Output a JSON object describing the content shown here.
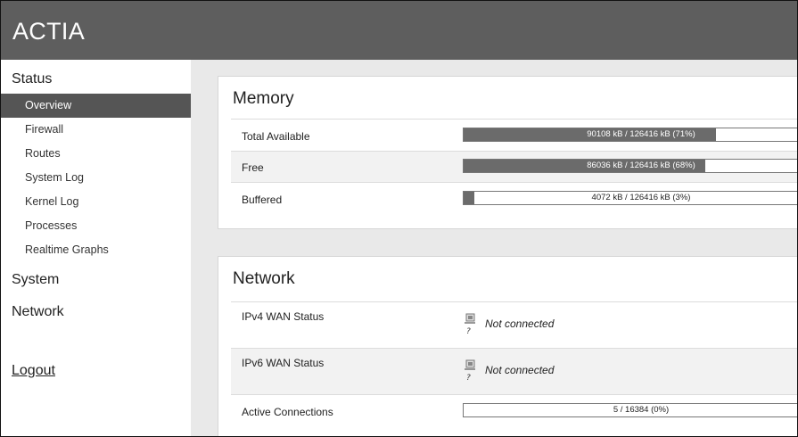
{
  "header": {
    "brand": "ACTIA"
  },
  "sidebar": {
    "status_label": "Status",
    "items": [
      {
        "label": "Overview",
        "active": true
      },
      {
        "label": "Firewall"
      },
      {
        "label": "Routes"
      },
      {
        "label": "System Log"
      },
      {
        "label": "Kernel Log"
      },
      {
        "label": "Processes"
      },
      {
        "label": "Realtime Graphs"
      }
    ],
    "system_label": "System",
    "network_label": "Network",
    "logout_label": "Logout"
  },
  "memory": {
    "title": "Memory",
    "rows": [
      {
        "label": "Total Available",
        "value_text": "90108 kB / 126416 kB (71%)",
        "percent": 71
      },
      {
        "label": "Free",
        "value_text": "86036 kB / 126416 kB (68%)",
        "percent": 68
      },
      {
        "label": "Buffered",
        "value_text": "4072 kB / 126416 kB (3%)",
        "percent": 3
      }
    ]
  },
  "network": {
    "title": "Network",
    "ipv4": {
      "label": "IPv4 WAN Status",
      "status": "Not connected",
      "icon_text": "?"
    },
    "ipv6": {
      "label": "IPv6 WAN Status",
      "status": "Not connected",
      "icon_text": "?"
    },
    "connections": {
      "label": "Active Connections",
      "value_text": "5 / 16384 (0%)",
      "percent": 0
    }
  },
  "colors": {
    "header": "#5e5e5e",
    "active_item": "#555555",
    "bar_fill": "#6b6b6b"
  }
}
